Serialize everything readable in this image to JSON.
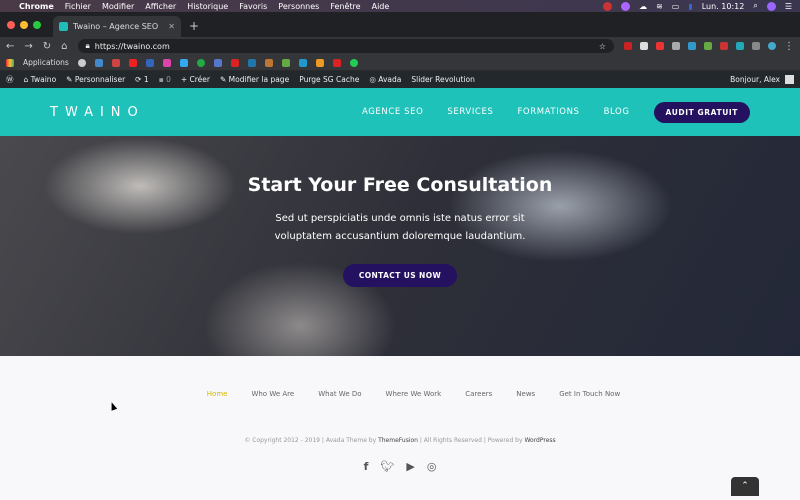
{
  "menubar": {
    "app": "Chrome",
    "items": [
      "Fichier",
      "Modifier",
      "Afficher",
      "Historique",
      "Favoris",
      "Personnes",
      "Fenêtre",
      "Aide"
    ],
    "clock": "Lun. 10:12"
  },
  "browser": {
    "tab_title": "Twaino – Agence SEO",
    "url": "https://twaino.com",
    "bookmarks_label": "Applications"
  },
  "wpbar": {
    "site": "Twaino",
    "customize": "Personnaliser",
    "updates": "1",
    "comments": "0",
    "create": "Créer",
    "edit": "Modifier la page",
    "purge": "Purge SG Cache",
    "avada": "Avada",
    "slider": "Slider Revolution",
    "greeting": "Bonjour, Alex"
  },
  "header": {
    "logo": "TWAINO",
    "nav": [
      "AGENCE SEO",
      "SERVICES",
      "FORMATIONS",
      "BLOG"
    ],
    "cta": "AUDIT GRATUIT",
    "brand_color": "#1ec2b9",
    "button_color": "#24115f"
  },
  "hero": {
    "title": "Start Your Free Consultation",
    "text": "Sed ut perspiciatis unde omnis iste natus error sit voluptatem accusantium doloremque laudantium.",
    "button": "CONTACT US NOW"
  },
  "footer": {
    "nav": [
      "Home",
      "Who We Are",
      "What We Do",
      "Where We Work",
      "Careers",
      "News",
      "Get In Touch Now"
    ],
    "copy_prefix": "© Copyright 2012 - 2019 | Avada Theme by ",
    "themefusion": "ThemeFusion",
    "copy_mid": " | All Rights Reserved | Powered by ",
    "wordpress": "WordPress",
    "social": [
      "facebook-icon",
      "twitter-icon",
      "youtube-icon",
      "instagram-icon"
    ]
  }
}
